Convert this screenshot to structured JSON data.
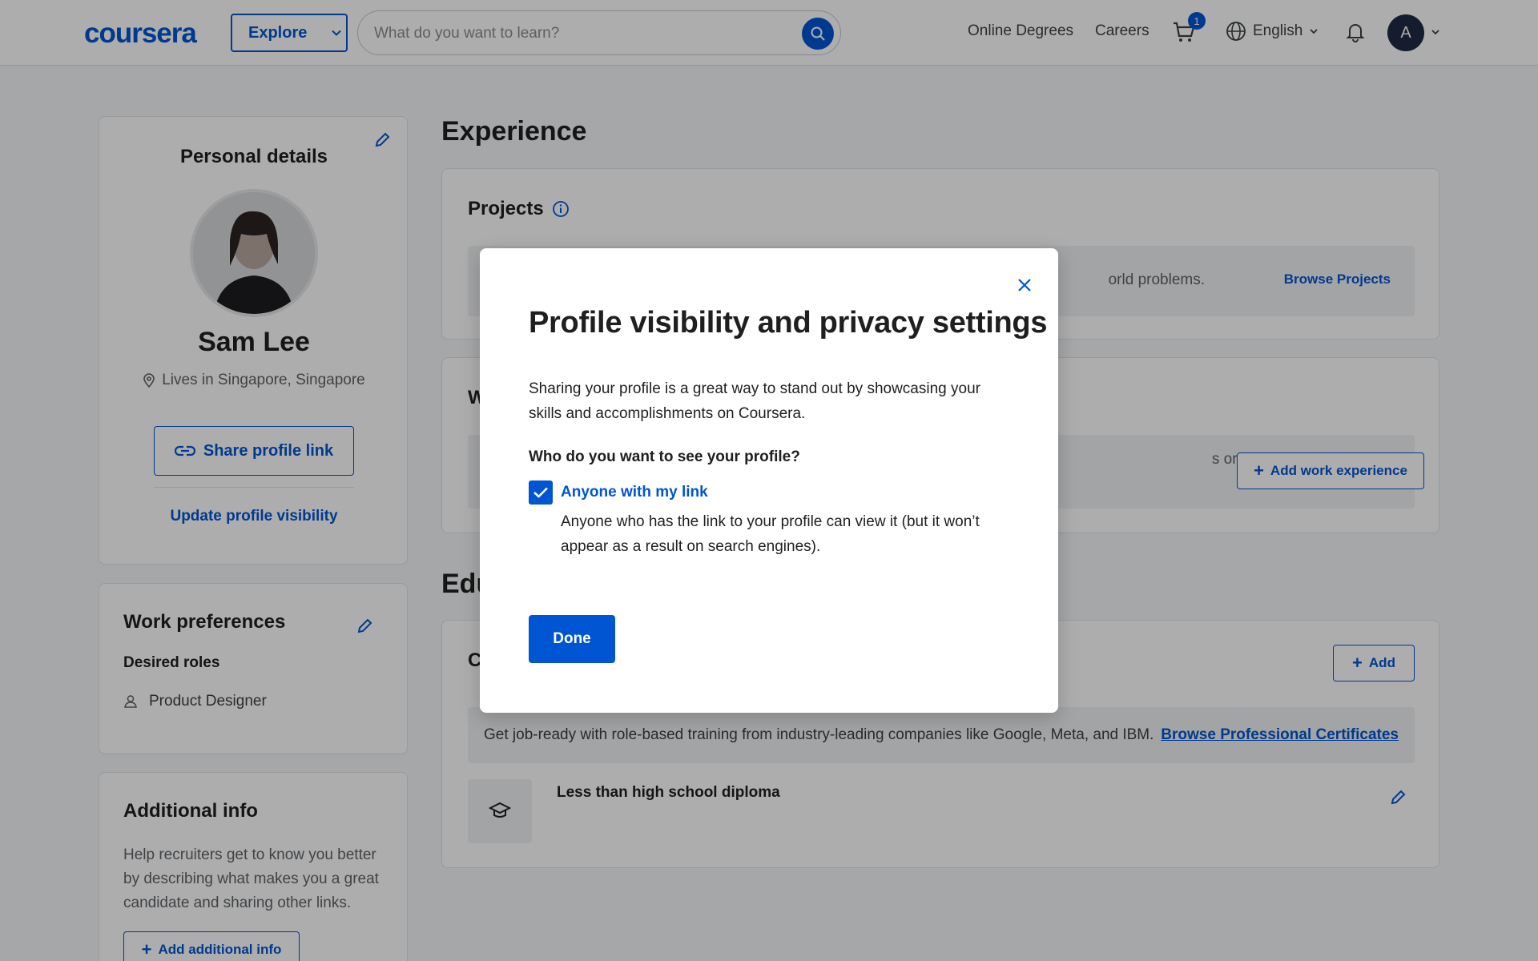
{
  "header": {
    "logo": "coursera",
    "explore_label": "Explore",
    "search_placeholder": "What do you want to learn?",
    "nav_online_degrees": "Online Degrees",
    "nav_careers": "Careers",
    "cart_count": "1",
    "language": "English",
    "avatar_initial": "A"
  },
  "personal_details": {
    "title": "Personal details",
    "name": "Sam Lee",
    "location": "Lives in Singapore, Singapore",
    "share_label": "Share profile link",
    "update_visibility_label": "Update profile visibility"
  },
  "work_preferences": {
    "title": "Work preferences",
    "desired_roles_label": "Desired roles",
    "roles": [
      "Product Designer"
    ]
  },
  "additional_info": {
    "title": "Additional info",
    "description": "Help recruiters get to know you better by describing what makes you a great candidate and sharing other links.",
    "add_label": "Add additional info"
  },
  "experience": {
    "title": "Experience",
    "projects": {
      "title": "Projects",
      "text_fragment": "orld problems.",
      "browse_label": "Browse Projects"
    },
    "work": {
      "title_fragment": "W",
      "text_fragment": "s or volunteer",
      "add_label": "Add work experience"
    }
  },
  "education": {
    "title_fragment": "Edu",
    "card_title_fragment": "C",
    "add_label": "Add",
    "banner_text": "Get job-ready with role-based training from industry-leading companies like Google, Meta, and IBM.",
    "banner_link": "Browse Professional Certificates",
    "item": "Less than high school diploma"
  },
  "modal": {
    "title": "Profile visibility and privacy settings",
    "description": "Sharing your profile is a great way to stand out by showcasing your skills and accomplishments on Coursera.",
    "question": "Who do you want to see your profile?",
    "option_label": "Anyone with my link",
    "option_checked": true,
    "option_description": "Anyone who has the link to your profile can view it (but it won’t appear as a result on search engines).",
    "done_label": "Done"
  },
  "colors": {
    "brand": "#0056d2",
    "overlay": "rgba(0,0,0,0.32)"
  }
}
